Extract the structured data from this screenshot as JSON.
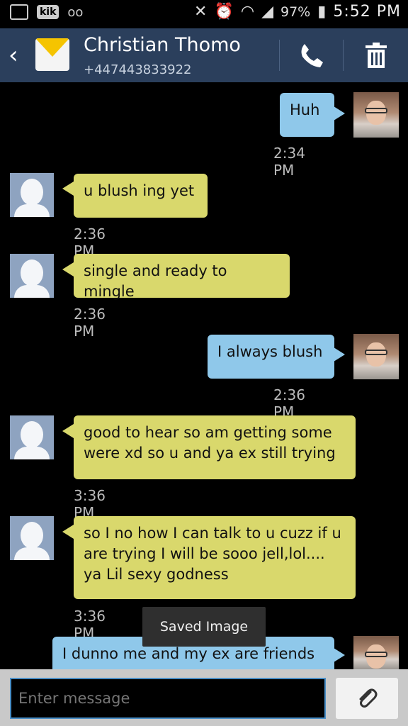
{
  "status_bar": {
    "kik_label": "kik",
    "battery": "97%",
    "time": "5:52 PM"
  },
  "header": {
    "contact_name": "Christian Thomo",
    "phone_number": "+447443833922"
  },
  "messages": [
    {
      "side": "out",
      "text": "Huh",
      "time": "2:34 PM"
    },
    {
      "side": "in",
      "text": "u blush ing yet",
      "time": "2:36 PM"
    },
    {
      "side": "in",
      "text": "single and ready to mingle",
      "time": "2:36 PM"
    },
    {
      "side": "out",
      "text": "I always blush",
      "time": "2:36 PM"
    },
    {
      "side": "in",
      "text": "good to hear so am getting some were xd so u and ya ex still trying",
      "time": "3:36 PM"
    },
    {
      "side": "in",
      "text": "so I no how I can talk to u cuzz if u are trying I will be sooo jell,lol.... ya Lil sexy godness",
      "time": "3:36 PM"
    },
    {
      "side": "out",
      "text": "I dunno me and my ex are friends",
      "time": ""
    }
  ],
  "toast": {
    "text": "Saved Image"
  },
  "composer": {
    "placeholder": "Enter message"
  },
  "colors": {
    "header_bg": "#2b3f5c",
    "incoming_bubble": "#d9d86c",
    "outgoing_bubble": "#8fc8ea",
    "input_border": "#4a8fc7"
  },
  "icons": [
    "gallery-icon",
    "kik-icon",
    "voicemail-icon",
    "mute-icon",
    "alarm-icon",
    "wifi-icon",
    "signal-icon",
    "battery-icon",
    "back-icon",
    "envelope-icon",
    "phone-icon",
    "trash-icon",
    "paperclip-icon"
  ]
}
